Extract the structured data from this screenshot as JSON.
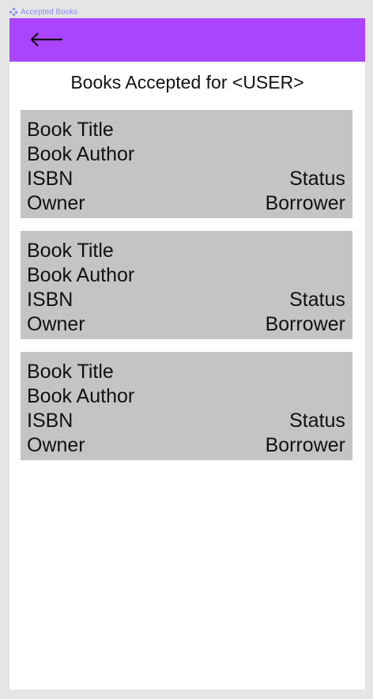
{
  "frame": {
    "label": "Accepted Books"
  },
  "colors": {
    "topbar": "#aa44ff",
    "card": "#c4c4c4",
    "page_bg": "#e5e5e5"
  },
  "header": {
    "back_icon": "arrow-left-icon"
  },
  "page": {
    "title": "Books Accepted for <USER>"
  },
  "books": [
    {
      "title": "Book Title",
      "author": "Book Author",
      "isbn": "ISBN",
      "status": "Status",
      "owner": "Owner",
      "borrower": "Borrower"
    },
    {
      "title": "Book Title",
      "author": "Book Author",
      "isbn": "ISBN",
      "status": "Status",
      "owner": "Owner",
      "borrower": "Borrower"
    },
    {
      "title": "Book Title",
      "author": "Book Author",
      "isbn": "ISBN",
      "status": "Status",
      "owner": "Owner",
      "borrower": "Borrower"
    }
  ]
}
